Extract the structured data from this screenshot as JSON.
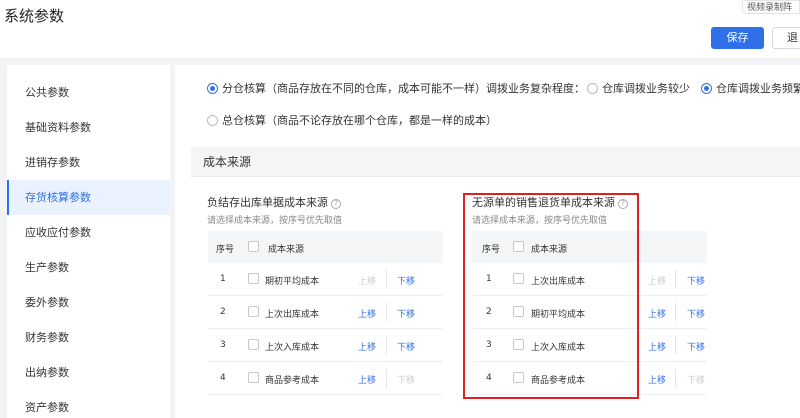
{
  "header": {
    "title": "系统参数",
    "record_tag": "视频录制阵",
    "save_label": "保存",
    "exit_label": "退"
  },
  "sidebar": {
    "items": [
      {
        "label": "公共参数"
      },
      {
        "label": "基础资料参数"
      },
      {
        "label": "进销存参数"
      },
      {
        "label": "存货核算参数",
        "active": true
      },
      {
        "label": "应收应付参数"
      },
      {
        "label": "生产参数"
      },
      {
        "label": "委外参数"
      },
      {
        "label": "财务参数"
      },
      {
        "label": "出纳参数"
      },
      {
        "label": "资产参数"
      }
    ]
  },
  "accounting": {
    "option_split": "分仓核算（商品存放在不同的仓库，成本可能不一样）",
    "option_total": "总仓核算（商品不论存放在哪个仓库，都是一样的成本）",
    "transfer_label": "调拨业务复杂程度：",
    "transfer_option_few": "仓库调拨业务较少",
    "transfer_option_many": "仓库调拨业务频繁"
  },
  "cost_source": {
    "section_title": "成本来源",
    "left": {
      "title": "负结存出库单据成本来源",
      "hint": "请选择成本来源，按序号优先取值",
      "col_no": "序号",
      "col_source": "成本来源",
      "rows": [
        {
          "no": "1",
          "source": "期初平均成本",
          "up": "上移",
          "down": "下移",
          "up_enabled": false,
          "down_enabled": true
        },
        {
          "no": "2",
          "source": "上次出库成本",
          "up": "上移",
          "down": "下移",
          "up_enabled": true,
          "down_enabled": true
        },
        {
          "no": "3",
          "source": "上次入库成本",
          "up": "上移",
          "down": "下移",
          "up_enabled": true,
          "down_enabled": true
        },
        {
          "no": "4",
          "source": "商品参考成本",
          "up": "上移",
          "down": "下移",
          "up_enabled": true,
          "down_enabled": false
        }
      ]
    },
    "right": {
      "title": "无源单的销售退货单成本来源",
      "hint": "请选择成本来源，按序号优先取值",
      "col_no": "序号",
      "col_source": "成本来源",
      "rows": [
        {
          "no": "1",
          "source": "上次出库成本",
          "up": "上移",
          "down": "下移",
          "up_enabled": false,
          "down_enabled": true
        },
        {
          "no": "2",
          "source": "期初平均成本",
          "up": "上移",
          "down": "下移",
          "up_enabled": true,
          "down_enabled": true
        },
        {
          "no": "3",
          "source": "上次入库成本",
          "up": "上移",
          "down": "下移",
          "up_enabled": true,
          "down_enabled": true
        },
        {
          "no": "4",
          "source": "商品参考成本",
          "up": "上移",
          "down": "下移",
          "up_enabled": true,
          "down_enabled": false
        }
      ]
    }
  },
  "colors": {
    "accent": "#2f6fe8",
    "highlight_border": "#e02020",
    "disabled_link": "#c7cbd2"
  }
}
